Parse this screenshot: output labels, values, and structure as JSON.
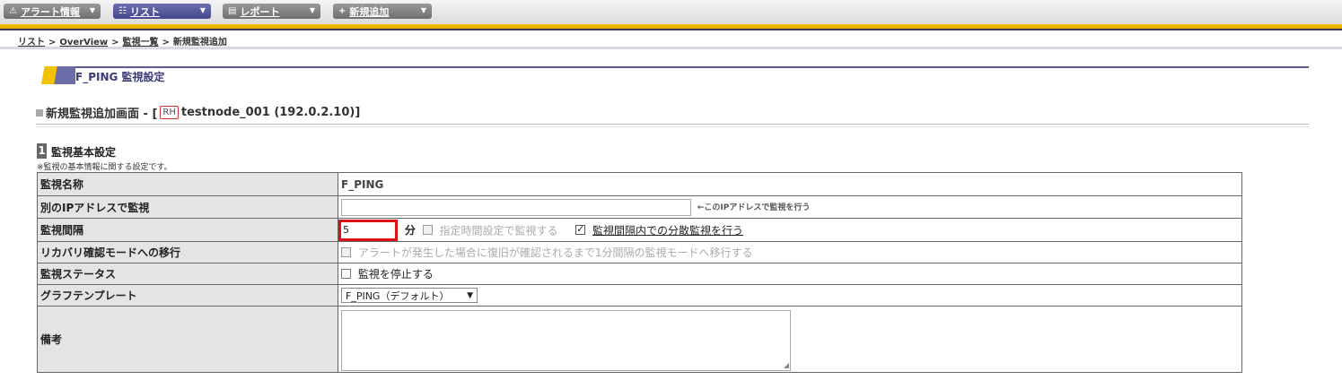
{
  "menu": [
    {
      "icon": "alert-icon",
      "label": "アラート情報",
      "active": false
    },
    {
      "icon": "list-icon",
      "label": "リスト",
      "active": true
    },
    {
      "icon": "report-icon",
      "label": "レポート",
      "active": false
    },
    {
      "icon": "add-icon",
      "label": "新規追加",
      "active": false
    }
  ],
  "breadcrumb": {
    "items": [
      "リスト",
      "OverView",
      "監視一覧"
    ],
    "current": "新規監視追加",
    "separator": ">"
  },
  "section_title": "F_PING 監視設定",
  "subtitle": {
    "prefix": "新規監視追加画面 - [",
    "badge": "RH",
    "node": "testnode_001 (192.0.2.10)]"
  },
  "block": {
    "number": "1",
    "title": "監視基本設定",
    "note": "※監視の基本情報に関する設定です。"
  },
  "rows": {
    "name_label": "監視名称",
    "name_value": "F_PING",
    "ip_label": "別のIPアドレスで監視",
    "ip_value": "",
    "ip_hint": "←このIPアドレスで監視を行う",
    "interval_label": "監視間隔",
    "interval_value": "5",
    "interval_unit": "分",
    "schedule_label": "指定時間設定で監視する",
    "distribute_label": "監視間隔内での分散監視を行う",
    "recovery_label": "リカバリ確認モードへの移行",
    "recovery_text": "アラートが発生した場合に復旧が確認されるまで1分間隔の監視モードへ移行する",
    "status_label": "監視ステータス",
    "status_text": "監視を停止する",
    "graph_label": "グラフテンプレート",
    "graph_value": "F_PING（デフォルト）",
    "note_label": "備考",
    "note_value": ""
  },
  "colors": {
    "accent": "#f2c200",
    "nav": "#44468a",
    "highlight": "#d11111"
  }
}
